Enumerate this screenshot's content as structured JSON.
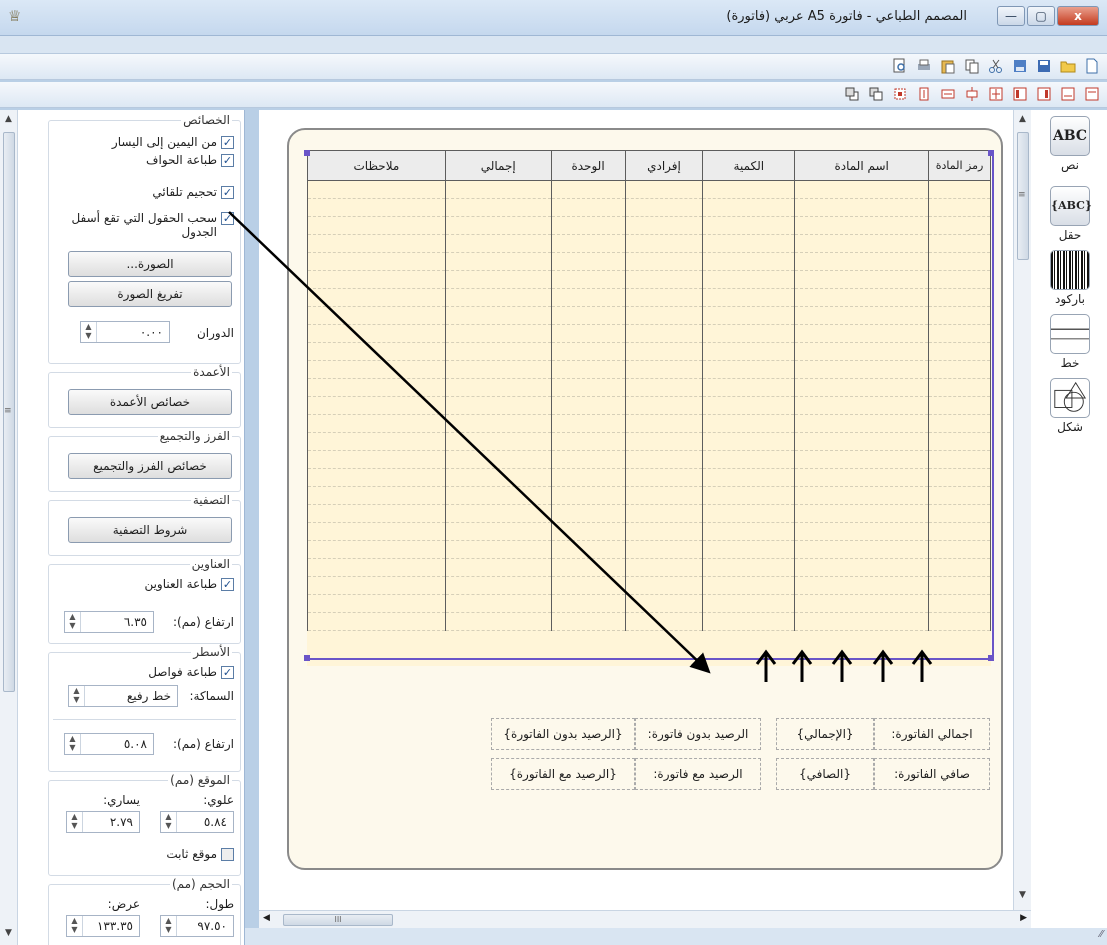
{
  "window": {
    "title": "المصمم الطباعي - فاتورة A5 عربي (فاتورة)",
    "close": "x",
    "maximize": "▢",
    "minimize": "—"
  },
  "properties": {
    "section_title": "الخصائص",
    "rtl_label": "من اليمين إلى اليسار",
    "print_borders_label": "طباعة الحواف",
    "auto_size_label": "تحجيم تلقائي",
    "pull_fields_label": "سحب الحقول التي تقع أسفل الجدول",
    "image_button": "الصورة...",
    "clear_image_button": "تفريغ الصورة",
    "rotation_label": "الدوران",
    "rotation_value": "٠.٠٠"
  },
  "columns_group": {
    "title": "الأعمدة",
    "button": "خصائص الأعمدة"
  },
  "sort_group": {
    "title": "الفرز والتجميع",
    "button": "خصائص الفرز والتجميع"
  },
  "filter_group": {
    "title": "التصفية",
    "button": "شروط التصفية"
  },
  "titles_group": {
    "title": "العناوين",
    "print_titles_label": "طباعة العناوين",
    "height_label": "ارتفاع (مم):",
    "height_value": "٦.٣٥"
  },
  "rows_group": {
    "title": "الأسطر",
    "print_separators_label": "طباعة فواصل",
    "thickness_label": "السماكة:",
    "thickness_value": "خط رفيع",
    "height_label": "ارتفاع (مم):",
    "height_value": "٥.٠٨"
  },
  "position_group": {
    "title": "الموقع (مم)",
    "top_label": "علوي:",
    "left_label": "يساري:",
    "top_value": "٥.٨٤",
    "left_value": "٢.٧٩",
    "fixed_label": "موقع ثابت"
  },
  "size_group": {
    "title": "الحجم (مم)",
    "length_label": "طول:",
    "width_label": "عرض:",
    "length_value": "٩٧.٥٠",
    "width_value": "١٣٣.٣٥"
  },
  "table": {
    "headers": [
      "رمز المادة",
      "اسم المادة",
      "الكمية",
      "إفرادي",
      "الوحدة",
      "إجمالي",
      "ملاحظات"
    ]
  },
  "fields": {
    "invoice_total_label": "اجمالي الفاتورة:",
    "invoice_total_value": "{الإجمالي}",
    "invoice_net_label": "صافي الفاتورة:",
    "invoice_net_value": "{الصافي}",
    "balance_without_label": "الرصيد بدون فاتورة:",
    "balance_without_value": "{الرصيد بدون الفاتورة}",
    "balance_with_label": "الرصيد مع فاتورة:",
    "balance_with_value": "{الرصيد مع الفاتورة}"
  },
  "palette": {
    "text": "نص",
    "field": "حقل",
    "barcode": "باركود",
    "line": "خط",
    "shape": "شكل",
    "text_icon": "ABC",
    "field_icon": "{ABC}"
  },
  "scrollbar": {
    "grip": "III",
    "side_grip": "≡"
  }
}
